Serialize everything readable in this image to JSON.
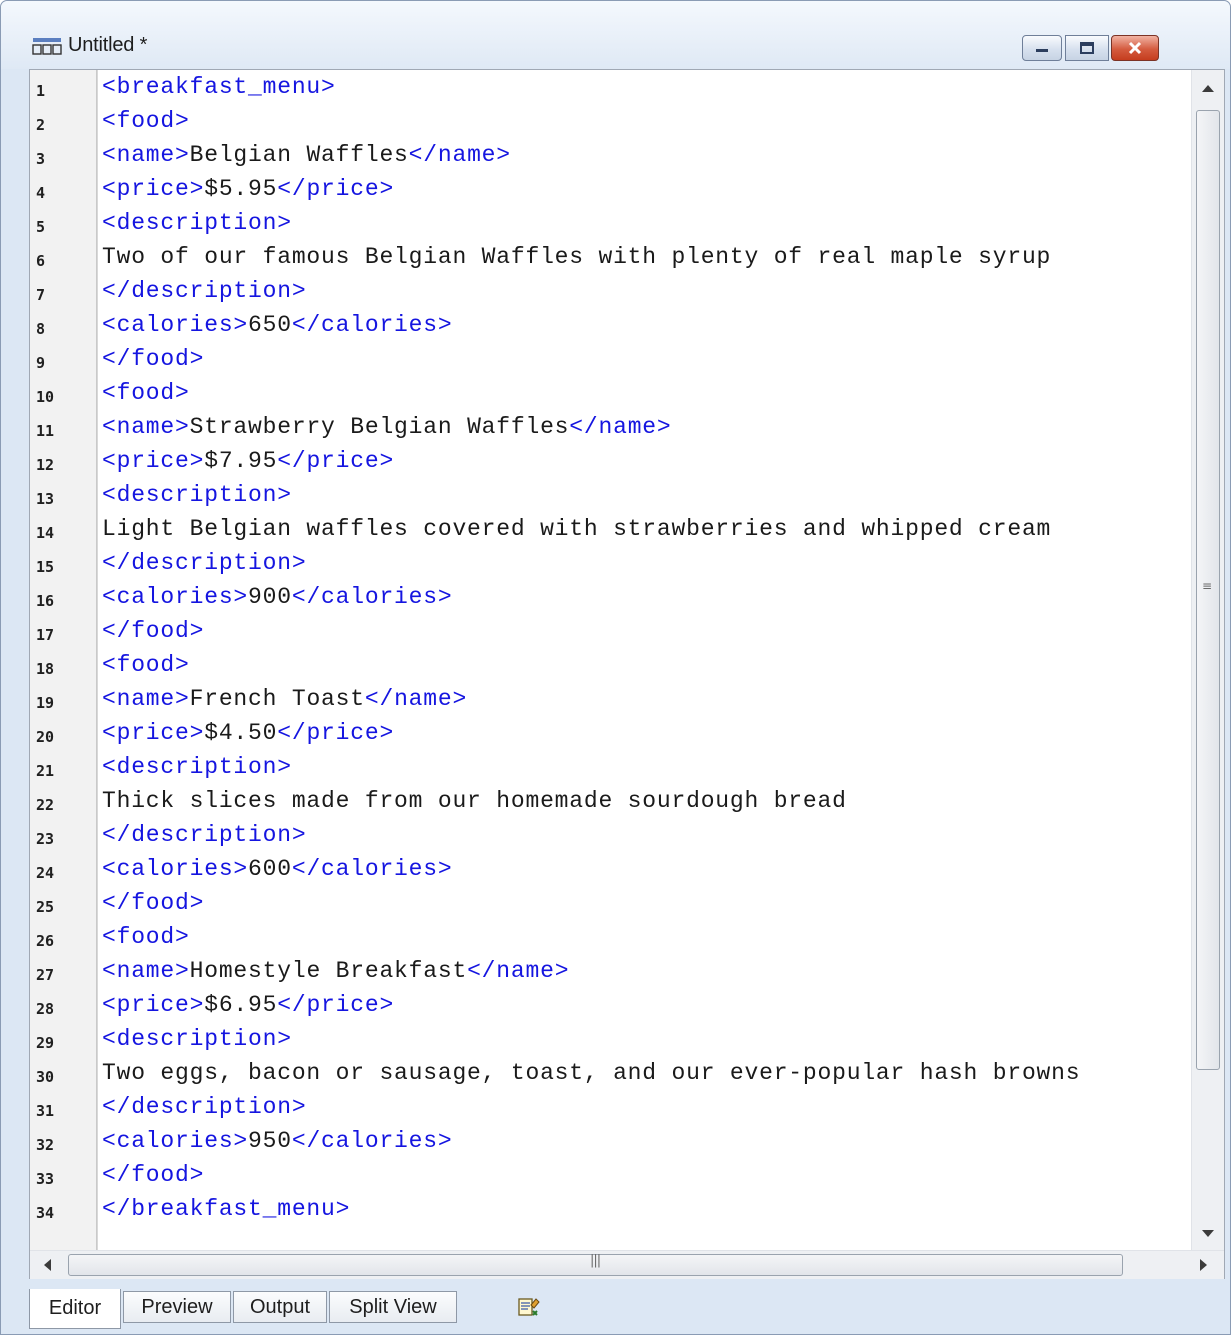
{
  "window": {
    "title": "Untitled *",
    "icon": "xml-document-icon",
    "controls": [
      "minimize-icon",
      "maximize-icon",
      "close-icon"
    ]
  },
  "editor": {
    "line_numbers": [
      "1",
      "2",
      "3",
      "4",
      "5",
      "6",
      "7",
      "8",
      "9",
      "10",
      "11",
      "12",
      "13",
      "14",
      "15",
      "16",
      "17",
      "18",
      "19",
      "20",
      "21",
      "22",
      "23",
      "24",
      "25",
      "26",
      "27",
      "28",
      "29",
      "30",
      "31",
      "32",
      "33",
      "34"
    ],
    "lines": [
      [
        {
          "t": "tag",
          "s": "<breakfast_menu>"
        }
      ],
      [
        {
          "t": "tag",
          "s": "<food>"
        }
      ],
      [
        {
          "t": "tag",
          "s": "<name>"
        },
        {
          "t": "txt",
          "s": "Belgian Waffles"
        },
        {
          "t": "tag",
          "s": "</name>"
        }
      ],
      [
        {
          "t": "tag",
          "s": "<price>"
        },
        {
          "t": "txt",
          "s": "$5.95"
        },
        {
          "t": "tag",
          "s": "</price>"
        }
      ],
      [
        {
          "t": "tag",
          "s": "<description>"
        }
      ],
      [
        {
          "t": "txt",
          "s": "Two of our famous Belgian Waffles with plenty of real maple syrup"
        }
      ],
      [
        {
          "t": "tag",
          "s": "</description>"
        }
      ],
      [
        {
          "t": "tag",
          "s": "<calories>"
        },
        {
          "t": "txt",
          "s": "650"
        },
        {
          "t": "tag",
          "s": "</calories>"
        }
      ],
      [
        {
          "t": "tag",
          "s": "</food>"
        }
      ],
      [
        {
          "t": "tag",
          "s": "<food>"
        }
      ],
      [
        {
          "t": "tag",
          "s": "<name>"
        },
        {
          "t": "txt",
          "s": "Strawberry Belgian Waffles"
        },
        {
          "t": "tag",
          "s": "</name>"
        }
      ],
      [
        {
          "t": "tag",
          "s": "<price>"
        },
        {
          "t": "txt",
          "s": "$7.95"
        },
        {
          "t": "tag",
          "s": "</price>"
        }
      ],
      [
        {
          "t": "tag",
          "s": "<description>"
        }
      ],
      [
        {
          "t": "txt",
          "s": "Light Belgian waffles covered with strawberries and whipped cream"
        }
      ],
      [
        {
          "t": "tag",
          "s": "</description>"
        }
      ],
      [
        {
          "t": "tag",
          "s": "<calories>"
        },
        {
          "t": "txt",
          "s": "900"
        },
        {
          "t": "tag",
          "s": "</calories>"
        }
      ],
      [
        {
          "t": "tag",
          "s": "</food>"
        }
      ],
      [
        {
          "t": "tag",
          "s": "<food>"
        }
      ],
      [
        {
          "t": "tag",
          "s": "<name>"
        },
        {
          "t": "txt",
          "s": "French Toast"
        },
        {
          "t": "tag",
          "s": "</name>"
        }
      ],
      [
        {
          "t": "tag",
          "s": "<price>"
        },
        {
          "t": "txt",
          "s": "$4.50"
        },
        {
          "t": "tag",
          "s": "</price>"
        }
      ],
      [
        {
          "t": "tag",
          "s": "<description>"
        }
      ],
      [
        {
          "t": "txt",
          "s": "Thick slices made from our homemade sourdough bread"
        }
      ],
      [
        {
          "t": "tag",
          "s": "</description>"
        }
      ],
      [
        {
          "t": "tag",
          "s": "<calories>"
        },
        {
          "t": "txt",
          "s": "600"
        },
        {
          "t": "tag",
          "s": "</calories>"
        }
      ],
      [
        {
          "t": "tag",
          "s": "</food>"
        }
      ],
      [
        {
          "t": "tag",
          "s": "<food>"
        }
      ],
      [
        {
          "t": "tag",
          "s": "<name>"
        },
        {
          "t": "txt",
          "s": "Homestyle Breakfast"
        },
        {
          "t": "tag",
          "s": "</name>"
        }
      ],
      [
        {
          "t": "tag",
          "s": "<price>"
        },
        {
          "t": "txt",
          "s": "$6.95"
        },
        {
          "t": "tag",
          "s": "</price>"
        }
      ],
      [
        {
          "t": "tag",
          "s": "<description>"
        }
      ],
      [
        {
          "t": "txt",
          "s": "Two eggs, bacon or sausage, toast, and our ever-popular hash browns"
        }
      ],
      [
        {
          "t": "tag",
          "s": "</description>"
        }
      ],
      [
        {
          "t": "tag",
          "s": "<calories>"
        },
        {
          "t": "txt",
          "s": "950"
        },
        {
          "t": "tag",
          "s": "</calories>"
        }
      ],
      [
        {
          "t": "tag",
          "s": "</food>"
        }
      ],
      [
        {
          "t": "tag",
          "s": "</breakfast_menu>"
        }
      ]
    ],
    "colors": {
      "tag": "#1515e0",
      "text": "#1a1a1a",
      "gutter": "#f2f2f2"
    }
  },
  "tabs": [
    {
      "label": "Editor",
      "active": true
    },
    {
      "label": "Preview",
      "active": false
    },
    {
      "label": "Output",
      "active": false
    },
    {
      "label": "Split View",
      "active": false
    }
  ],
  "tab_extra_icon": "validate-document-icon"
}
